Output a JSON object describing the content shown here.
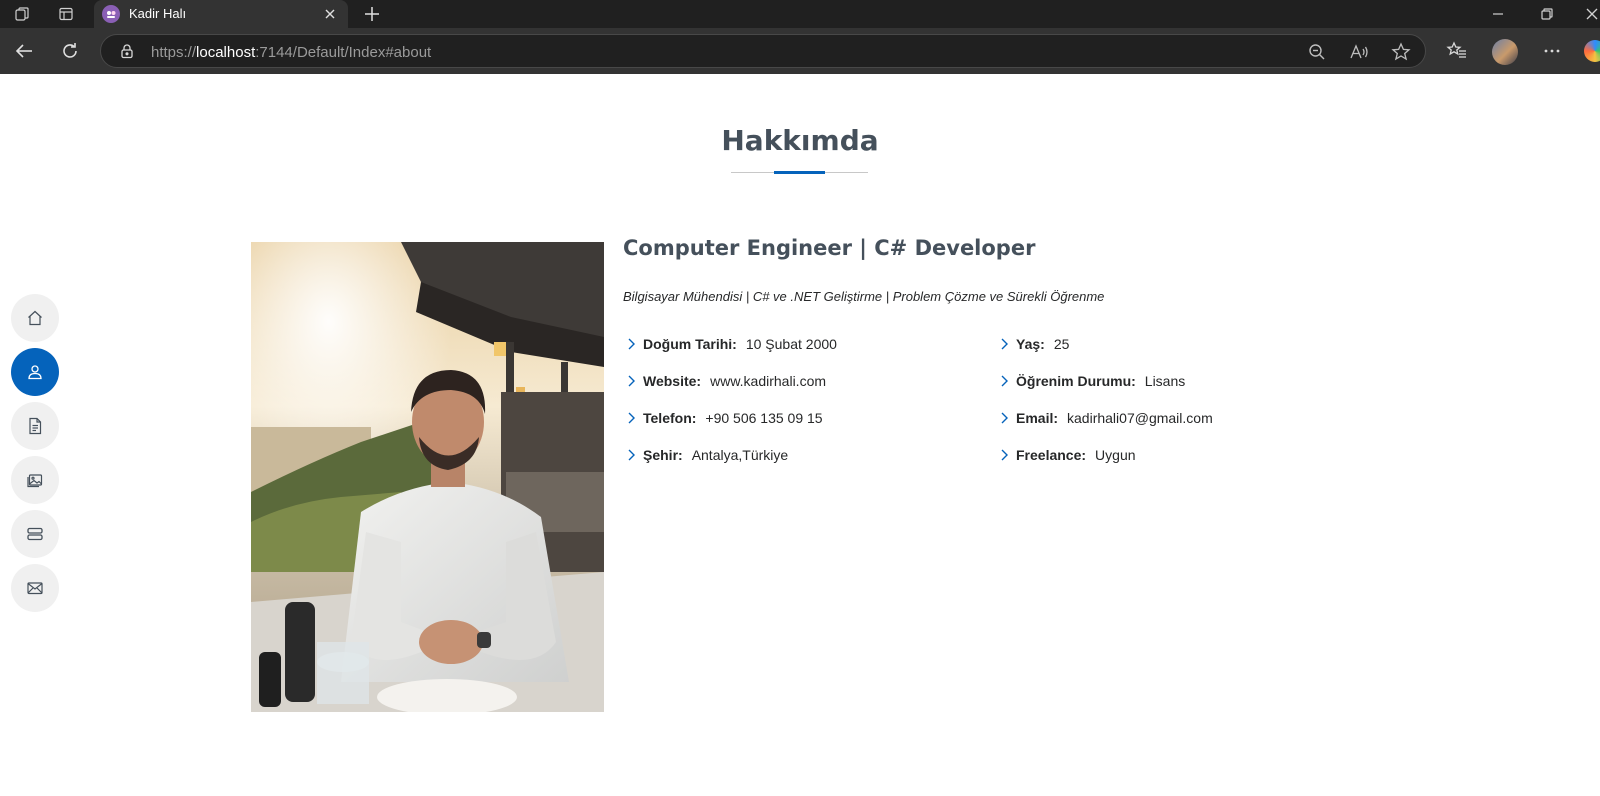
{
  "browser": {
    "tab_title": "Kadir Halı",
    "url_scheme": "https://",
    "url_host": "localhost",
    "url_rest": ":7144/Default/Index#about"
  },
  "side_nav": [
    {
      "name": "home",
      "icon": "home-icon",
      "active": false
    },
    {
      "name": "about",
      "icon": "person-icon",
      "active": true
    },
    {
      "name": "resume",
      "icon": "file-text-icon",
      "active": false
    },
    {
      "name": "portfolio",
      "icon": "images-icon",
      "active": false
    },
    {
      "name": "services",
      "icon": "server-icon",
      "active": false
    },
    {
      "name": "contact",
      "icon": "envelope-icon",
      "active": false
    }
  ],
  "about": {
    "section_title": "Hakkımda",
    "heading": "Computer Engineer | C# Developer",
    "subtitle": "Bilgisayar Mühendisi | C# ve .NET Geliştirme | Problem Çözme ve Sürekli Öğrenme",
    "left_info": [
      {
        "label": "Doğum Tarihi:",
        "value": "10 Şubat 2000"
      },
      {
        "label": "Website:",
        "value": "www.kadirhali.com"
      },
      {
        "label": "Telefon:",
        "value": "+90 506 135 09 15"
      },
      {
        "label": "Şehir:",
        "value": "Antalya,Türkiye"
      }
    ],
    "right_info": [
      {
        "label": "Yaş:",
        "value": "25"
      },
      {
        "label": "Öğrenim Durumu:",
        "value": "Lisans"
      },
      {
        "label": "Email:",
        "value": "kadirhali07@gmail.com"
      },
      {
        "label": "Freelance:",
        "value": "Uygun"
      }
    ]
  },
  "colors": {
    "accent": "#0563bb",
    "heading": "#45505b",
    "nav_bg": "#f0f0f0"
  }
}
